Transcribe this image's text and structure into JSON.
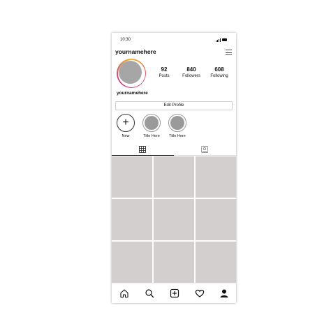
{
  "status_bar": {
    "time": "10:30"
  },
  "header": {
    "username": "yournamehere"
  },
  "profile": {
    "stats": [
      {
        "value": "92",
        "label": "Posts"
      },
      {
        "value": "840",
        "label": "Followers"
      },
      {
        "value": "608",
        "label": "Following"
      }
    ],
    "display_name": "yournamehere",
    "edit_button": "Edit Profile"
  },
  "highlights": [
    {
      "label": "New",
      "type": "new"
    },
    {
      "label": "Title Here",
      "type": "story"
    },
    {
      "label": "Title Here",
      "type": "story"
    }
  ],
  "tabs": [
    {
      "icon": "grid-icon",
      "active": true
    },
    {
      "icon": "tagged-icon",
      "active": false
    }
  ],
  "bottom_nav": [
    "home-icon",
    "search-icon",
    "add-post-icon",
    "heart-icon",
    "profile-icon"
  ],
  "colors": {
    "placeholder_cell": "#d4cfcf",
    "avatar_ring": [
      "#f5b428",
      "#e8336e",
      "#c13584"
    ]
  }
}
